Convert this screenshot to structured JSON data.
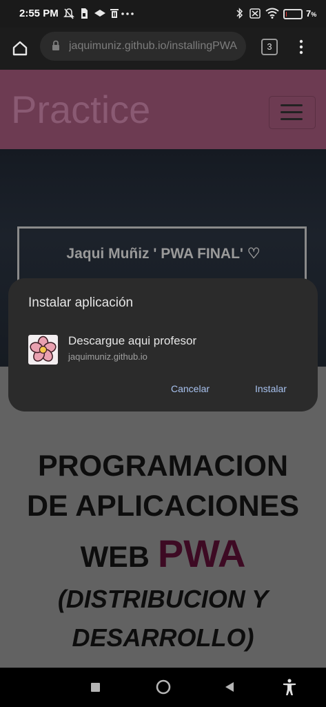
{
  "status_bar": {
    "time": "2:55 PM",
    "battery_text": "7",
    "battery_unit": "%",
    "battery_level": 0.07,
    "left_icons": [
      "silent-icon",
      "sim-icon",
      "cloud-icon",
      "trash-icon",
      "more-dots-icon"
    ],
    "right_icons": [
      "bluetooth-icon",
      "no-sim-icon",
      "wifi-icon",
      "battery-icon"
    ]
  },
  "browser": {
    "url": "jaquimuniz.github.io/installingPWA",
    "tab_count": "3"
  },
  "site": {
    "nav_title": "Practice",
    "hero_title": "Jaqui Muñiz ' PWA FINAL' ♡",
    "headline_line1": "PROGRAMACION",
    "headline_line2": "DE APLICACIONES",
    "headline_line3_prefix": "WEB ",
    "headline_line3_accent": "PWA",
    "subheadline_line1": "(DISTRIBUCION Y",
    "subheadline_line2": "DESARROLLO)"
  },
  "install_dialog": {
    "title": "Instalar aplicación",
    "app_name": "Descargue aqui profesor",
    "app_domain": "jaquimuniz.github.io",
    "cancel_label": "Cancelar",
    "install_label": "Instalar"
  },
  "colors": {
    "status_bar_bg": "#1a1a1a",
    "toolbar_bg": "#1c1c1c",
    "dialog_bg": "#2b2b2b",
    "dialog_button_text": "#a8c2ef",
    "site_nav_bg": "#6d3b52",
    "accent_pwa": "#3d0a23"
  }
}
